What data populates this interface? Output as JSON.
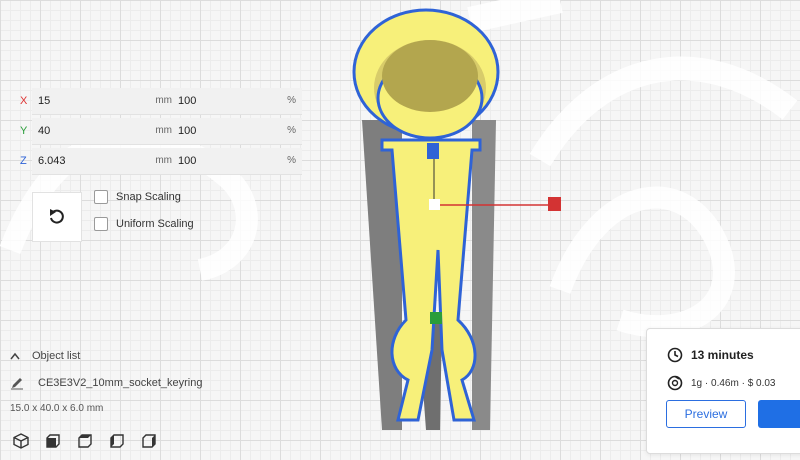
{
  "transform": {
    "rows": [
      {
        "axis": "X",
        "value": "15",
        "unit": "mm",
        "scale": "100",
        "scale_unit": "%"
      },
      {
        "axis": "Y",
        "value": "40",
        "unit": "mm",
        "scale": "100",
        "scale_unit": "%"
      },
      {
        "axis": "Z",
        "value": "6.043",
        "unit": "mm",
        "scale": "100",
        "scale_unit": "%"
      }
    ],
    "snap_scaling_label": "Snap Scaling",
    "uniform_scaling_label": "Uniform Scaling"
  },
  "object_list": {
    "header": "Object list",
    "item_name": "CE3E3V2_10mm_socket_keyring",
    "dimensions": "15.0 x 40.0 x 6.0 mm"
  },
  "print_info": {
    "time": "13 minutes",
    "material": "1g · 0.46m · $ 0.03",
    "preview_label": "Preview"
  },
  "colors": {
    "model_fill": "#f7f07a",
    "model_outline": "#2f63d6",
    "accent_blue": "#1f6fe5",
    "axis_x": "#d33333",
    "axis_y": "#2a9d3a",
    "axis_z": "#2f63d6"
  }
}
